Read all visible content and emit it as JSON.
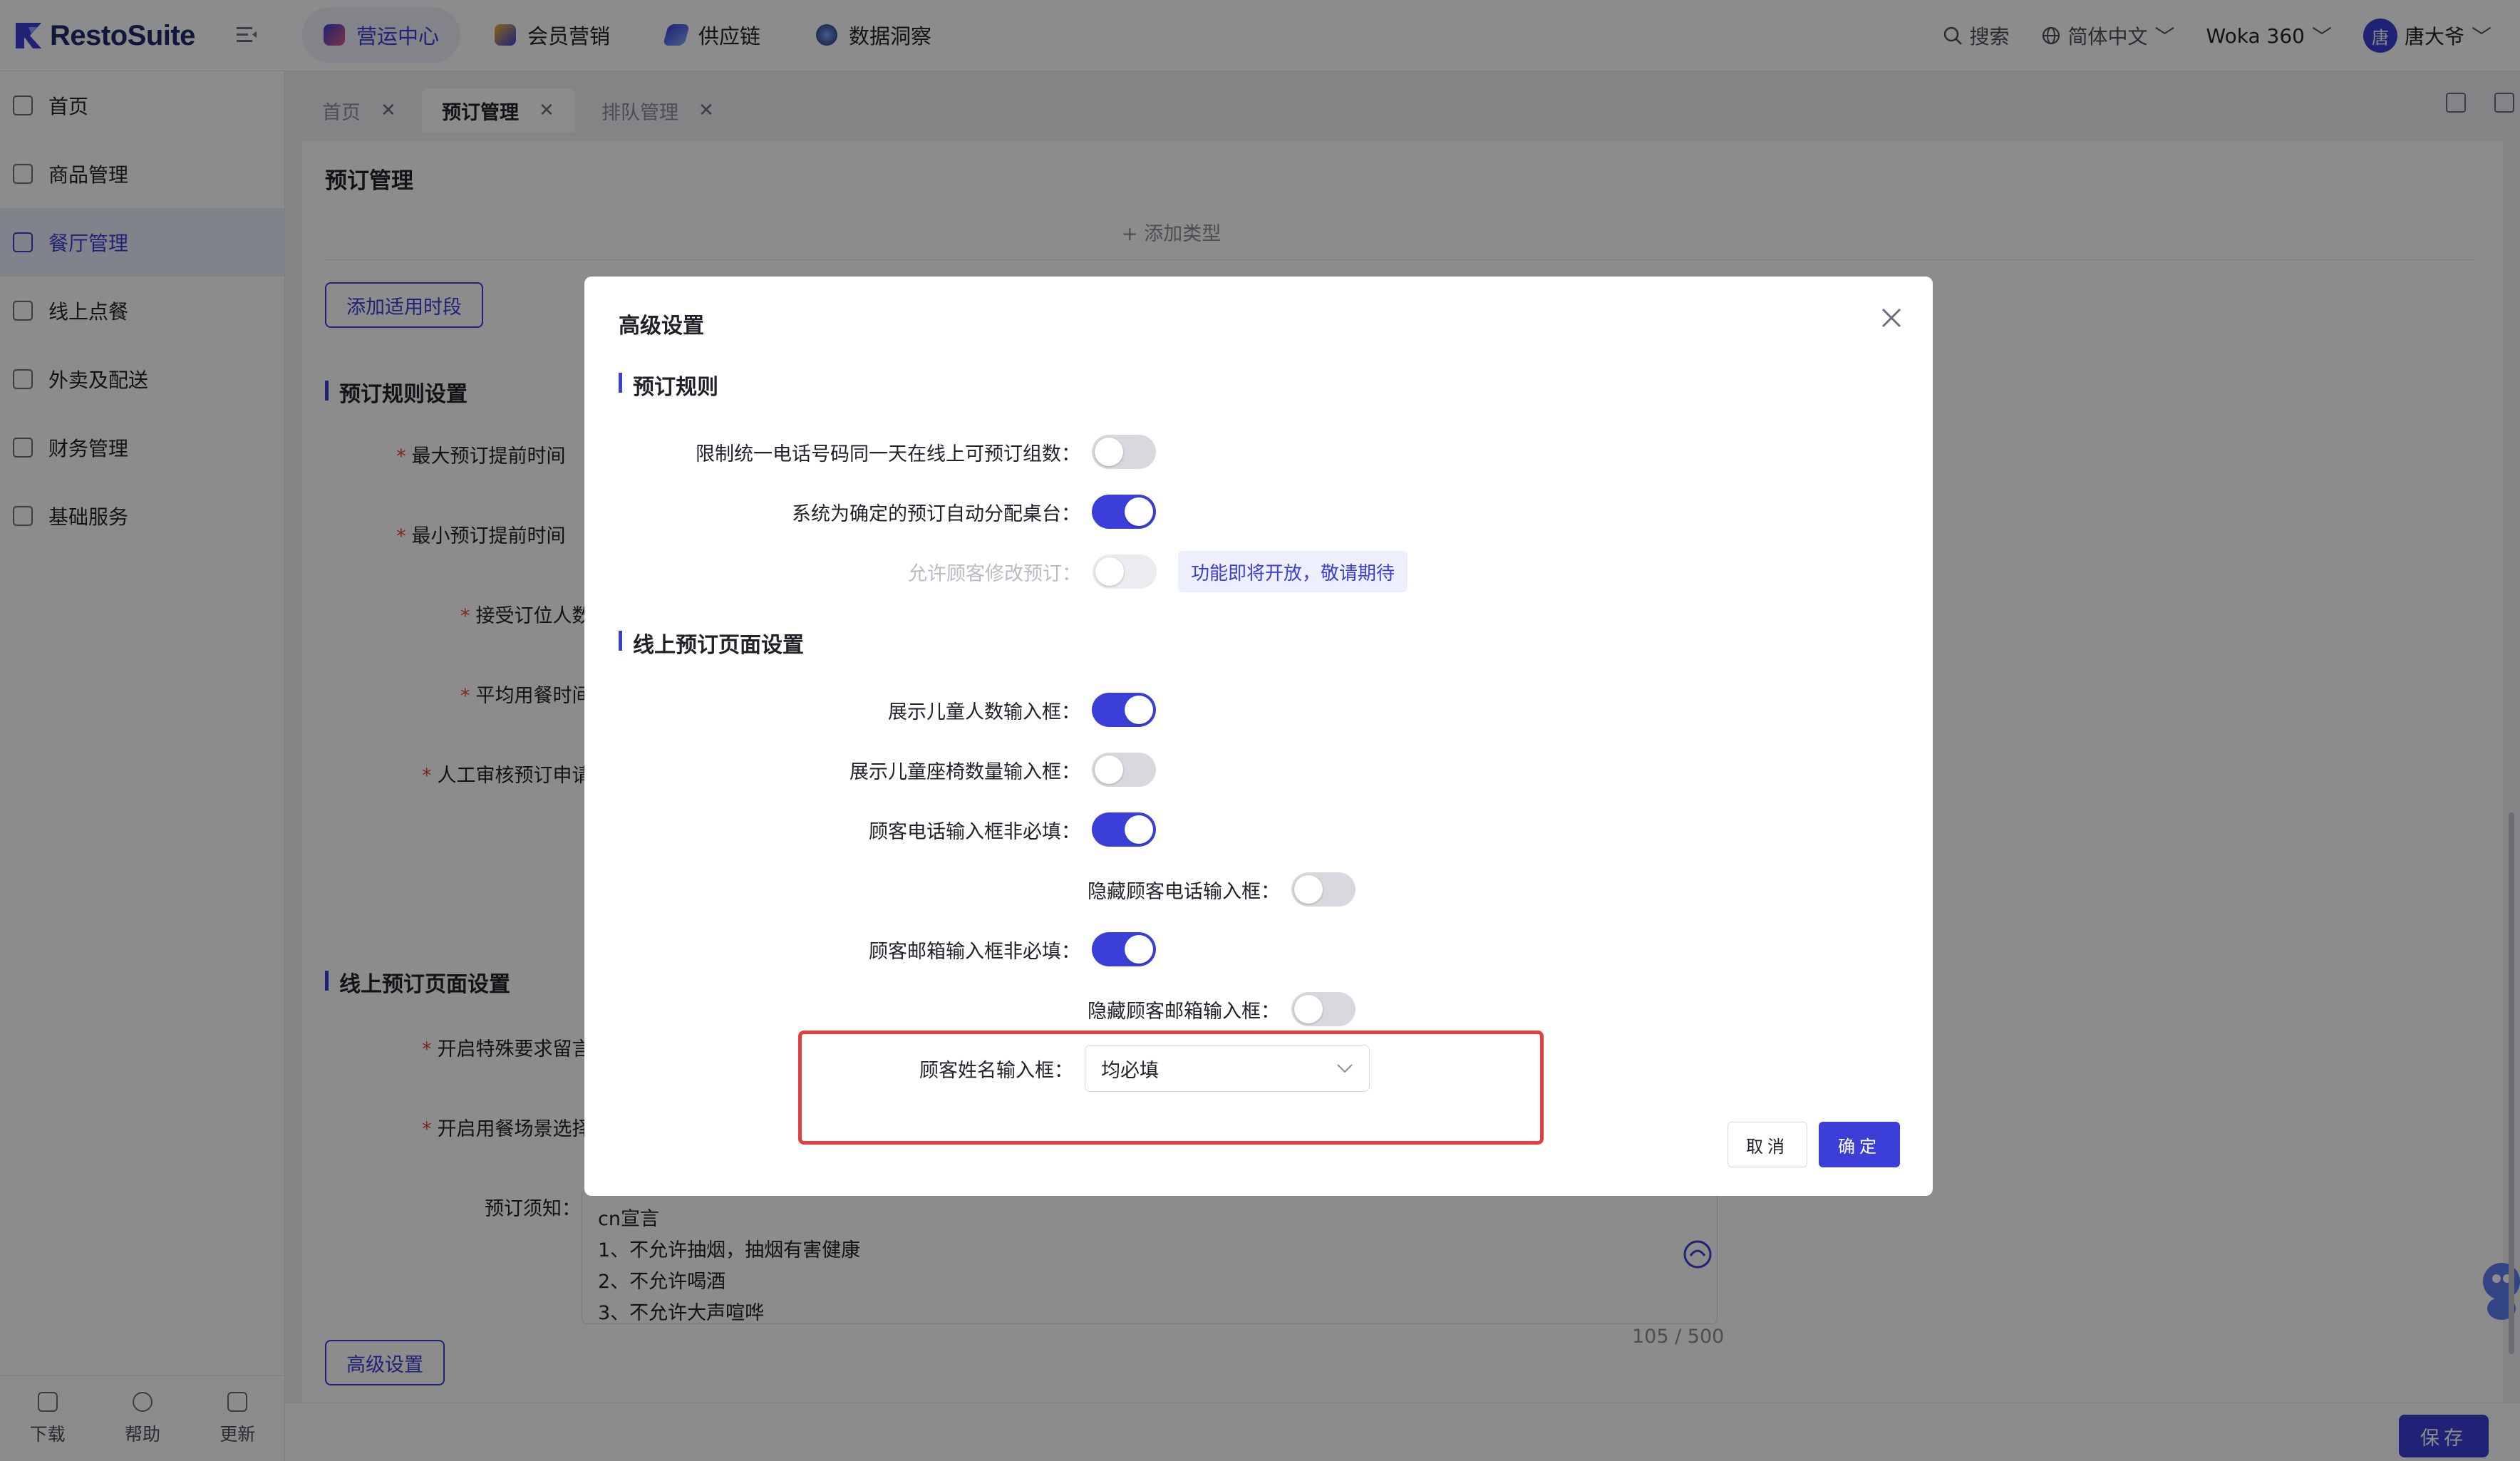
{
  "app": {
    "logo_text": "RestoSuite"
  },
  "topnav": [
    {
      "label": "营运中心",
      "active": true
    },
    {
      "label": "会员营销",
      "active": false
    },
    {
      "label": "供应链",
      "active": false
    },
    {
      "label": "数据洞察",
      "active": false
    }
  ],
  "topright": {
    "search_label": "搜索",
    "language_label": "简体中文",
    "store_label": "Woka 360",
    "avatar_char": "唐",
    "user_name": "唐大爷"
  },
  "sidebar": {
    "items": [
      {
        "label": "首页",
        "icon": "home-icon"
      },
      {
        "label": "商品管理",
        "icon": "box-icon"
      },
      {
        "label": "餐厅管理",
        "icon": "store-icon",
        "active": true
      },
      {
        "label": "线上点餐",
        "icon": "hand-icon"
      },
      {
        "label": "外卖及配送",
        "icon": "bag-icon"
      },
      {
        "label": "财务管理",
        "icon": "wallet-icon"
      },
      {
        "label": "基础服务",
        "icon": "grid-icon"
      }
    ],
    "bottom": [
      {
        "label": "下载",
        "icon": "download-icon"
      },
      {
        "label": "帮助",
        "icon": "help-icon"
      },
      {
        "label": "更新",
        "icon": "update-icon"
      }
    ]
  },
  "tabs": [
    {
      "label": "首页",
      "active": false
    },
    {
      "label": "预订管理",
      "active": true
    },
    {
      "label": "排队管理",
      "active": false
    }
  ],
  "page": {
    "title": "预订管理",
    "add_type_label": "+ 添加类型",
    "add_period_button": "添加适用时段",
    "section_rules": "预订规则设置",
    "fields": [
      "最大预订提前时间",
      "最小预订提前时间",
      "接受订位人数",
      "平均用餐时间",
      "人工审核预订申请"
    ],
    "section_online": "线上预订页面设置",
    "online_fields": [
      "开启特殊要求留言",
      "开启用餐场景选择"
    ],
    "notice_label": "预订须知：",
    "notice_lines": [
      "cn宣言",
      "1、不允许抽烟，抽烟有害健康",
      "2、不允许喝酒",
      "3、不允许大声喧哗"
    ],
    "notice_counter": "105 / 500",
    "advanced_button": "高级设置",
    "save_button": "保存"
  },
  "modal": {
    "title": "高级设置",
    "section_rules": "预订规则",
    "rule_rows": [
      {
        "label": "限制统一电话号码同一天在线上可预订组数：",
        "on": false,
        "disabled": false
      },
      {
        "label": "系统为确定的预订自动分配桌台：",
        "on": true,
        "disabled": false
      },
      {
        "label": "允许顾客修改预订：",
        "on": false,
        "disabled": true,
        "tag": "功能即将开放，敬请期待"
      }
    ],
    "section_online": "线上预订页面设置",
    "online_rows": [
      {
        "label": "展示儿童人数输入框：",
        "on": true
      },
      {
        "label": "展示儿童座椅数量输入框：",
        "on": false
      },
      {
        "label": "顾客电话输入框非必填：",
        "on": true
      },
      {
        "label": "隐藏顾客电话输入框：",
        "on": false
      },
      {
        "label": "顾客邮箱输入框非必填：",
        "on": true
      },
      {
        "label": "隐藏顾客邮箱输入框：",
        "on": false
      }
    ],
    "name_field_label": "顾客姓名输入框：",
    "name_field_value": "均必填",
    "cancel_button": "取消",
    "ok_button": "确定",
    "accent_color": "#3b3fd8",
    "highlight_color": "#e53e3e"
  }
}
